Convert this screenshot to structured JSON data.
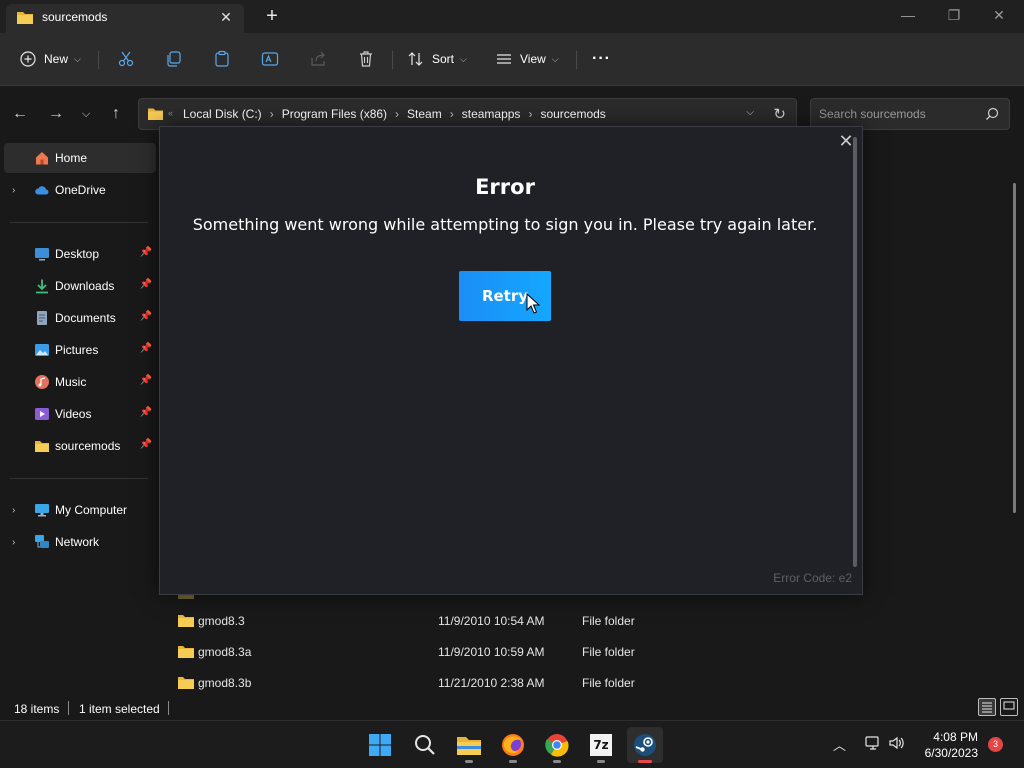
{
  "tab": {
    "title": "sourcemods",
    "icon": "folder-icon"
  },
  "window": {
    "minimize": "—",
    "maximize": "❐",
    "close": "✕"
  },
  "commandbar": {
    "new_label": "New",
    "sort_label": "Sort",
    "view_label": "View",
    "more": "···"
  },
  "address": {
    "crumbs": [
      "Local Disk (C:)",
      "Program Files (x86)",
      "Steam",
      "steamapps",
      "sourcemods"
    ],
    "search_placeholder": "Search sourcemods"
  },
  "sidebar": {
    "items": [
      {
        "label": "Home",
        "icon": "home-icon"
      },
      {
        "label": "OneDrive",
        "icon": "cloud-icon"
      },
      {
        "label": "Desktop",
        "icon": "desktop-icon"
      },
      {
        "label": "Downloads",
        "icon": "download-icon"
      },
      {
        "label": "Documents",
        "icon": "document-icon"
      },
      {
        "label": "Pictures",
        "icon": "pictures-icon"
      },
      {
        "label": "Music",
        "icon": "music-icon"
      },
      {
        "label": "Videos",
        "icon": "video-icon"
      },
      {
        "label": "sourcemods",
        "icon": "folder-icon"
      },
      {
        "label": "My Computer",
        "icon": "computer-icon"
      },
      {
        "label": "Network",
        "icon": "network-icon"
      }
    ]
  },
  "files": [
    {
      "name": "gmod8.3",
      "date": "11/9/2010 10:54 AM",
      "type": "File folder"
    },
    {
      "name": "gmod8.3a",
      "date": "11/9/2010 10:59 AM",
      "type": "File folder"
    },
    {
      "name": "gmod8.3b",
      "date": "11/21/2010 2:38 AM",
      "type": "File folder"
    }
  ],
  "status": {
    "count": "18 items",
    "selected": "1 item selected"
  },
  "taskbar": {
    "time": "4:08 PM",
    "date": "6/30/2023",
    "notifications": "3",
    "apps": [
      "windows-start",
      "search",
      "file-explorer",
      "firefox",
      "chrome",
      "7zip",
      "steam"
    ],
    "sevenzip_label": "7z"
  },
  "dialog": {
    "title": "Error",
    "message": "Something went wrong while attempting to sign you in. Please try again later.",
    "retry_label": "Retry",
    "error_code": "Error Code: e2",
    "close": "✕"
  },
  "colors": {
    "explorer_bg": "#191919",
    "dialog_bg": "#1f2126",
    "retry_blue": "#1a9fff",
    "folder_yellow": "#f4c542",
    "badge_red": "#e64545"
  }
}
